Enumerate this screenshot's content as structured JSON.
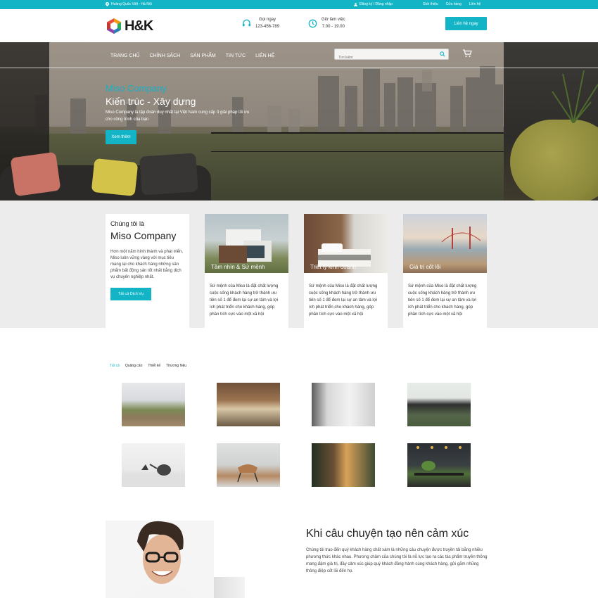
{
  "topbar": {
    "address": "Hoàng Quốc Việt - Hà Nội",
    "auth": "Đăng ký / Đăng nhập",
    "links": [
      "Giới thiệu",
      "Cửa hàng",
      "Liên hệ"
    ]
  },
  "header": {
    "logo": "H&K",
    "phone_label": "Gọi ngay",
    "phone": "123-456-789",
    "hours_label": "Giờ làm việc",
    "hours": "7.00 - 19.00",
    "cta": "Liên hệ ngay"
  },
  "nav": {
    "items": [
      "TRANG CHỦ",
      "CHÍNH SÁCH",
      "SẢN PHẨM",
      "TIN TỨC",
      "LIÊN HỆ"
    ],
    "search_placeholder": "Tìm kiếm"
  },
  "hero": {
    "brand": "Miso Company",
    "title": "Kiến trúc - Xây dựng",
    "desc": "Miso Company là tập đoàn duy nhất tại Việt Nam cung cấp 3 giải pháp tối ưu cho công trình của bạn",
    "button": "Xem thêm"
  },
  "about": {
    "pre": "Chúng tôi là",
    "name": "Miso Company",
    "text": "Hơn một năm hình thành và phát triển, Miso luôn vững vàng với mục tiêu mang lại cho khách hàng những sản phẩm bất động sản tốt nhất bằng dịch vụ chuyên nghiệp nhất.",
    "button": "Tất cả Dịch Vụ",
    "features": [
      {
        "caption": "Tầm nhìn & Sứ mệnh",
        "text": "Sứ mệnh của Miso là đặt chất lượng cuộc sống khách hàng trở thành ưu tiên số 1 để đem lại sự an tâm và lợi ích phát triển cho khách hàng, góp phần tích cực vào một xã hội"
      },
      {
        "caption": "Triết lý kinh doanh",
        "text": "Sứ mệnh của Miso là đặt chất lượng cuộc sống khách hàng trở thành ưu tiên số 1 để đem lại sự an tâm và lợi ích phát triển cho khách hàng, góp phần tích cực vào một xã hội"
      },
      {
        "caption": "Giá trị cốt lõi",
        "text": "Sứ mệnh của Miso là đặt chất lượng cuộc sống khách hàng trở thành ưu tiên số 1 để đem lại sự an tâm và lợi ích phát triển cho khách hàng, góp phần tích cực vào một xã hội"
      }
    ]
  },
  "gallery": {
    "tabs": [
      "Tất cả",
      "Quảng cáo",
      "Thiết kế",
      "Thương hiệu"
    ]
  },
  "story": {
    "title": "Khi câu chuyện tạo nên cảm xúc",
    "text": "Chúng tôi trao đến quý khách hàng chất xám là những câu chuyện được truyền tải bằng nhiều phương thức khác nhau. Phương châm của chúng tôi là nỗ lực tạo ra các tác phẩm truyền thông mang đậm giá trị, đầy cảm xúc giúp quý khách đồng hành cùng khách hàng, gửi gắm những thông điệp cốt lõi đến họ."
  },
  "colors": {
    "accent": "#12b4c6"
  }
}
